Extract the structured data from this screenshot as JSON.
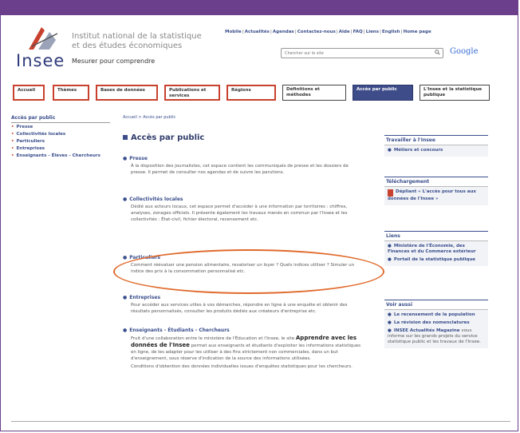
{
  "header": {
    "brand": "Insee",
    "institute_line1": "Institut national de la statistique",
    "institute_line2": "et des études économiques",
    "tagline": "Mesurer pour comprendre",
    "top_links": [
      "Mobile",
      "Actualités",
      "Agendas",
      "Contactez-nous",
      "Aide",
      "FAQ",
      "Liens",
      "English",
      "Home page"
    ],
    "search_placeholder": "Chercher sur le site",
    "search_engine": "Google"
  },
  "nav": {
    "tabs": [
      {
        "label": "Accueil"
      },
      {
        "label": "Thèmes"
      },
      {
        "label": "Bases de données"
      },
      {
        "label": "Publications et services"
      },
      {
        "label": "Régions"
      },
      {
        "label": "Définitions et méthodes"
      },
      {
        "label": "Accès par public"
      },
      {
        "label": "L'Insee et la statistique publique"
      }
    ]
  },
  "sidebar": {
    "heading": "Accès par public",
    "items": [
      {
        "label": "Presse"
      },
      {
        "label": "Collectivités locales"
      },
      {
        "label": "Particuliers"
      },
      {
        "label": "Entreprises"
      },
      {
        "label": "Enseignants - Élèves - Chercheurs"
      }
    ]
  },
  "main": {
    "breadcrumb": "Accueil > Accès par public",
    "title": "Accès par public",
    "sections": [
      {
        "heading": "Presse",
        "text": "À la disposition des journalistes, cet espace contient les communiqués de presse et les dossiers de presse. Il permet de consulter nos agendas et de suivre les parutions."
      },
      {
        "heading": "Collectivités locales",
        "text": "Dédié aux acteurs locaux, cet espace permet d'accéder à une information par territoires : chiffres, analyses, zonages officiels. Il présente également les travaux menés en commun par l'Insee et les collectivités : État-civil, fichier électoral, recensement etc."
      },
      {
        "heading": "Particuliers",
        "text": "Comment réévaluer une pension alimentaire, revaloriser un loyer ? Quels indices utiliser ? Simuler un indice des prix à la consommation personnalisé etc."
      },
      {
        "heading": "Entreprises",
        "text": "Pour accéder aux services utiles à vos démarches, répondre en ligne à une enquête et obtenir des résultats personnalisés, consulter les produits dédiés aux créateurs d'entreprise etc."
      },
      {
        "heading": "Enseignants - Étudiants - Chercheurs",
        "text_before": "Fruit d'une collaboration entre le ministère de l'Éducation et l'Insee, le site",
        "strong": "Apprendre avec les données de l'Insee",
        "text_after": "permet aux enseignants et étudiants d'exploiter les informations statistiques en ligne, de les adapter pour les utiliser à des fins strictement non commerciales, dans un but d'enseignement, sous réserve d'indication de la source des informations utilisées.",
        "extra": "Conditions d'obtention des données individuelles issues d'enquêtes statistiques pour les chercheurs."
      }
    ]
  },
  "right": {
    "boxes": [
      {
        "heading": "Travailler à l'Insee",
        "items": [
          {
            "label": "Métiers et concours"
          }
        ]
      },
      {
        "heading": "Téléchargement",
        "items": [
          {
            "label": "Dépliant « L'accès pour tous aux données de l'Insee »"
          }
        ]
      },
      {
        "heading": "Liens",
        "items": [
          {
            "label": "Ministère de l'Économie, des Finances et du Commerce extérieur"
          },
          {
            "label": "Portail de la statistique publique"
          }
        ]
      },
      {
        "heading": "Voir aussi",
        "items": [
          {
            "label": "Le recensement de la population"
          },
          {
            "label": "La révision des nomenclatures"
          },
          {
            "label": "INSEE Actualités Magazine",
            "sub": "vous informe sur les grands projets du service statistique public et les travaux de l'Insee."
          }
        ]
      }
    ]
  },
  "colors": {
    "brand_purple": "#6b3f8c",
    "link_blue": "#3a4e8c",
    "highlight_orange": "#e06a2c",
    "tab_red": "#c8412e"
  }
}
